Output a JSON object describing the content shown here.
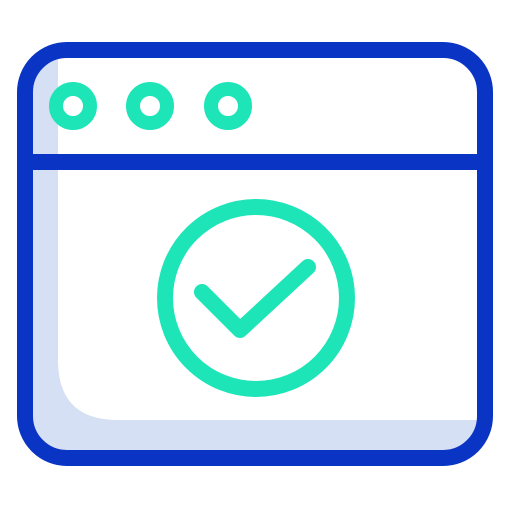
{
  "icon": {
    "name": "browser-window-check-icon",
    "colors": {
      "outline": "#0a35c4",
      "accent": "#1de5b8",
      "shadow_fill": "#d6e0f4",
      "background": "#ffffff"
    },
    "window_control_dots": 3
  }
}
